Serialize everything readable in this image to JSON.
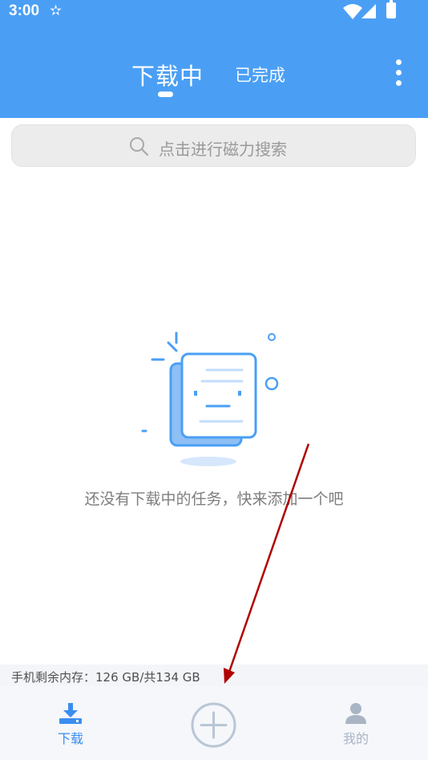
{
  "status_bar": {
    "time": "3:00",
    "icons": [
      "star-icon",
      "wifi-icon",
      "signal-icon",
      "battery-icon"
    ]
  },
  "header": {
    "tabs": [
      {
        "label": "下载中",
        "active": true
      },
      {
        "label": "已完成",
        "active": false
      }
    ],
    "menu_icon": "more-vert-icon"
  },
  "search": {
    "placeholder": "点击进行磁力搜索",
    "icon": "search-icon"
  },
  "empty_state": {
    "message": "还没有下载中的任务，快来添加一个吧",
    "illustration": "empty-documents-illustration"
  },
  "storage": {
    "text": "手机剩余内存：126 GB/共134 GB"
  },
  "bottom_nav": {
    "items": [
      {
        "label": "下载",
        "icon": "download-icon",
        "active": true
      },
      {
        "label": "",
        "icon": "add-circle-icon",
        "active": false
      },
      {
        "label": "我的",
        "icon": "user-icon",
        "active": false
      }
    ]
  },
  "colors": {
    "primary": "#4a9ff5",
    "nav_active": "#3a8ef0",
    "nav_inactive": "#a9b4c4",
    "annotation_arrow": "#b00000"
  }
}
